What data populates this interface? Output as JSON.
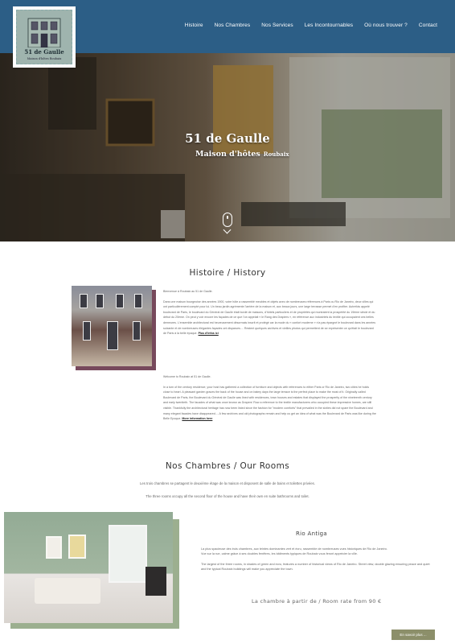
{
  "brand": {
    "name": "51 de Gaulle",
    "tagline": "Maison d'hôtes Roubaix"
  },
  "nav": [
    "Histoire",
    "Nos Chambres",
    "Nos Services",
    "Les Incontournables",
    "Où nous trouver ?",
    "Contact"
  ],
  "hero": {
    "title": "51 de Gaulle",
    "subtitle": "Maison d'hôtes",
    "city": "Roubaix"
  },
  "history": {
    "title": "Histoire / History",
    "fr_greeting": "Bienvenue à Roubaix au 51 de Gaulle.",
    "fr_body": "Dans une maison bourgeoise des années 1900, votre hôte a rassemblé meubles et objets avec de nombreuses références à Paris ou Rio de Janeiro, deux villes qui ont particulièrement compté pour lui. Un beau jardin agrémente l'arrière de la maison et, aux beaux jours, une large terrasse permet d'en profiter. Autrefois appelé boulevard de Paris, le boulevard du Général de Gaulle était bordé de maisons, d'hôtels particuliers et de propriétés qui montraient la prospérité du 19ème siècle et du début du 20ème. On peut y voir encore les façades de ce que l'on appelait « le Rang des Drapiers », en référence aux industriels du textile qui occupaient ces belles demeures. L'ensemble architectural est heureusement désormais inscrit et protégé car la mode du « confort moderne » n'a pas épargné le boulevard dans les années soixante et de nombreuses élégantes façades ont disparues.... Restent quelques archives et vieilles photos qui permettent de se représenter ce qu'était le boulevard de Paris à la belle époque.",
    "fr_link": "Plus d'infos ici",
    "en_greeting": "Welcome to Roubaix at 51 de Gaulle.",
    "en_body": "In a turn of the century residence, your host has gathered a collection of furniture and objects with references to either Paris or Rio de Janeiro, two cities he holds close to heart. A pleasant garden graces the back of the house and on balmy days the large terrace is the perfect place to make the most of it. Originally called Boulevard de Paris, the Boulevard du Général de Gaulle was lined with residences, town houses and estates that displayed the prosperity of the nineteenth century and early twentieth. The facades of what was once known as Drapers' Row a reference to the textile manufacturers who occupied these impressive homes, are still visible. Thankfully the architectural heritage has now been listed since the fashion for \"modern comforts\" that prevailed in the sixties did not spare the Boulevard and many elegant facades have disappeared.... A few archives and old photographs remain and help us get an idea of what was the Boulevard de Paris was like during the Belle Epoque.",
    "en_link": "More information here"
  },
  "rooms": {
    "title": "Nos Chambres / Our Rooms",
    "intro_fr": "Les trois chambres se partagent le deuxième étage de la maison et disposent de salle de bains et toilettes privées.",
    "intro_en": "The three rooms occupy all the second floor of the house and have their own en suite bathrooms and toilet.",
    "room_name": "Rio Antiga",
    "desc_fr_1": "La plus spacieuse des trois chambres, aux teintes dominantes vert et écru, rassemble de nombreuses vues historiques de Rio de Janeiro.",
    "desc_fr_2": "Vue sur la rue, calme grâce à ses doubles fenêtres, les bâtiments typiques de Roubaix vous feront apprécier la ville.",
    "desc_en": "The largest of the three rooms, in shades of green and ecru, features a number of historical views of Rio de Janeiro. Street view, double glazing ensuring peace and quiet and the typical Roubaix buildings will make you appreciate the town.",
    "price": "La chambre à partir de / Room rate from 90 €",
    "more_button": "En savoir plus ..."
  }
}
